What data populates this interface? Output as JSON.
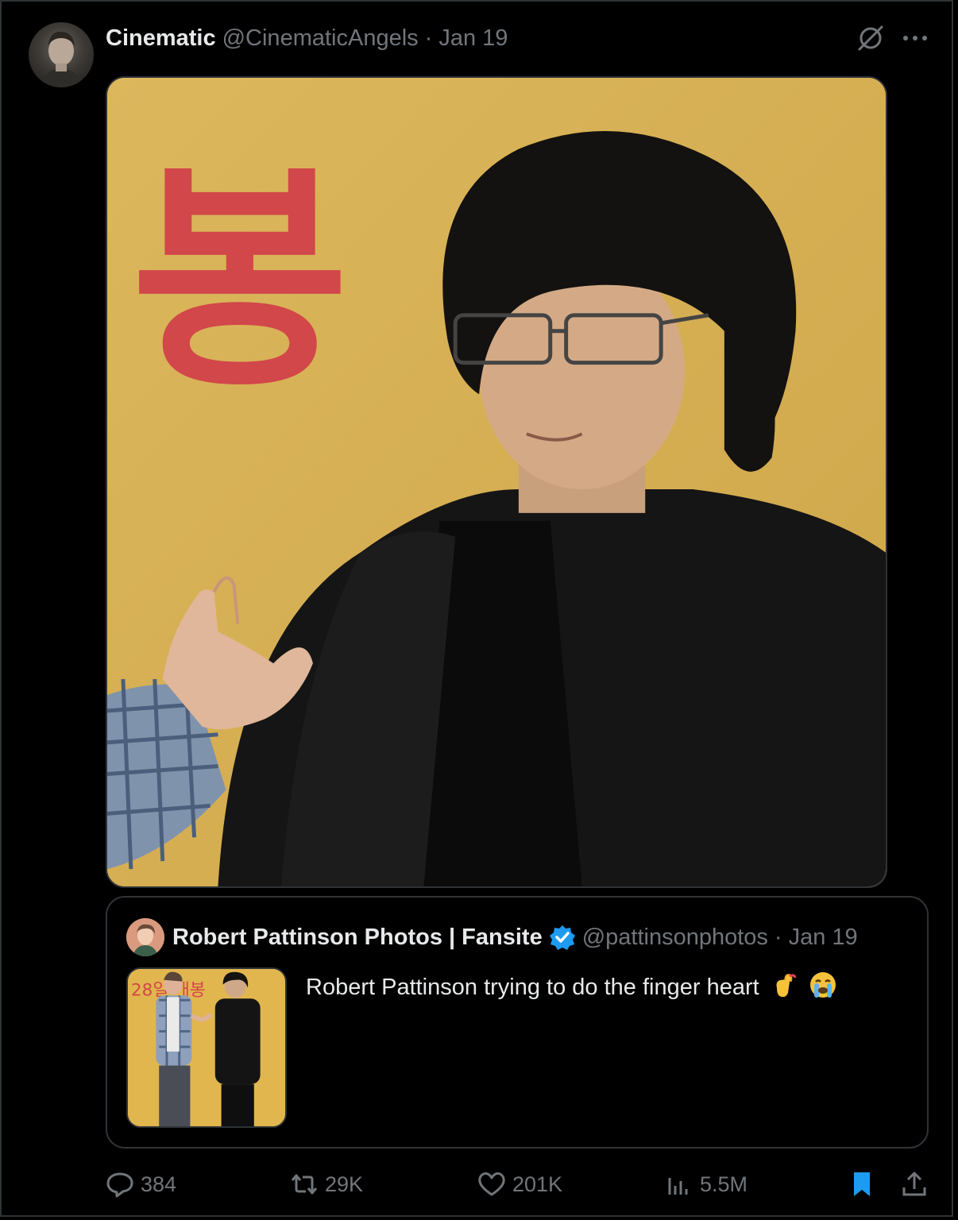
{
  "tweet": {
    "author_name": "Cinematic",
    "author_handle": "@CinematicAngels",
    "separator": "·",
    "date": "Jan 19",
    "media": {
      "description_alt": "",
      "sign_text": "봉"
    }
  },
  "quoted": {
    "author_name": "Robert Pattinson Photos | Fansite",
    "author_handle": "@pattinsonphotos",
    "separator": "·",
    "date": "Jan 19",
    "verified": true,
    "text": "Robert Pattinson trying to do the finger heart",
    "thumb_sign_text": "28일 개봉"
  },
  "actions": {
    "replies": "384",
    "retweets": "29K",
    "likes": "201K",
    "views": "5.5M"
  },
  "colors": {
    "background": "#000000",
    "border": "#2f3336",
    "muted": "#71767b",
    "text": "#e7e9ea",
    "accent": "#1d9bf0",
    "poster_yellow": "#d9b45a",
    "sign_red": "#d1474a"
  },
  "icons": [
    "grok-icon",
    "more-icon",
    "verified-badge-icon",
    "reply-icon",
    "retweet-icon",
    "like-icon",
    "views-icon",
    "bookmark-icon",
    "share-icon"
  ]
}
